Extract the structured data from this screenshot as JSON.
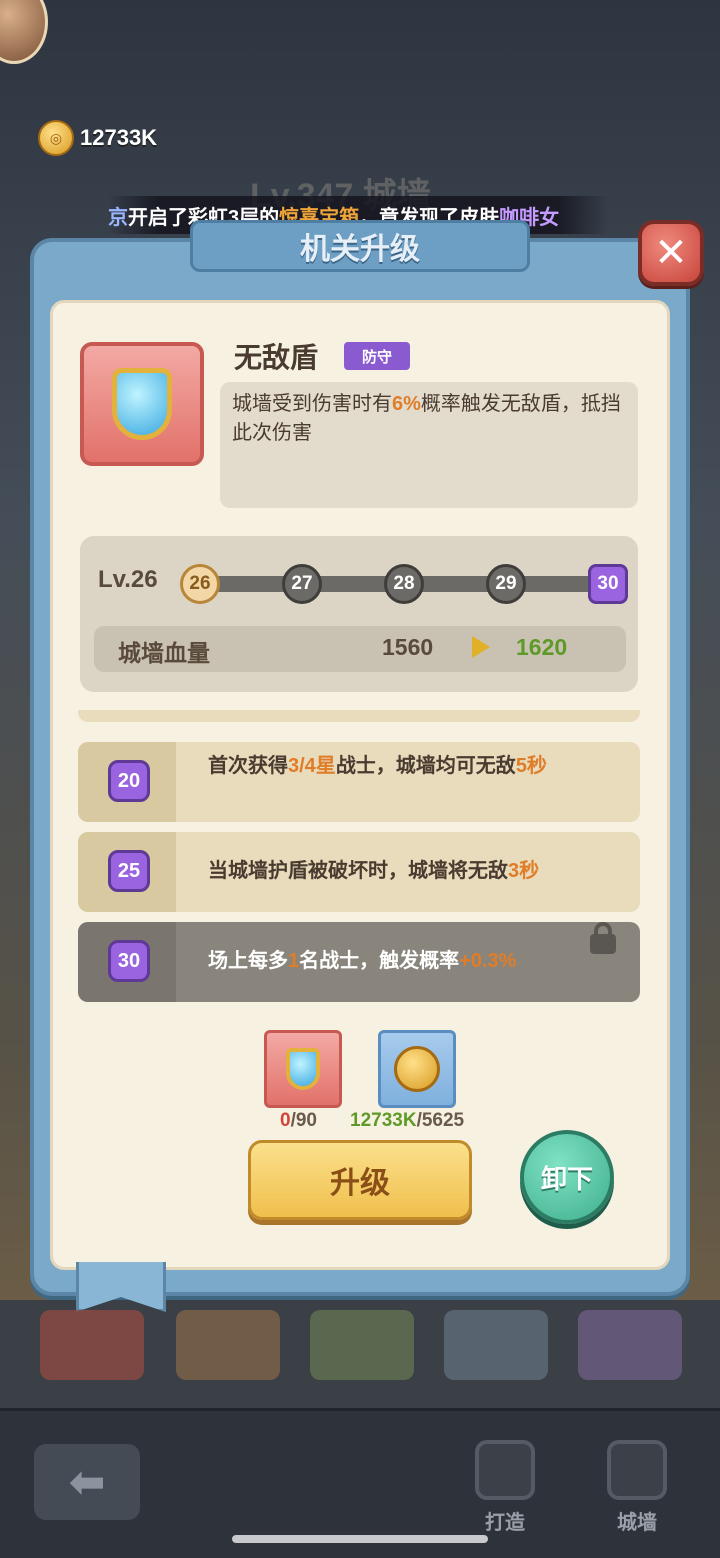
{
  "currency": {
    "amount": "12733K"
  },
  "background": {
    "title": "Lv.347 城墙"
  },
  "ticker": {
    "prefix": "京",
    "part1": "开启了彩虹3层的",
    "highlight1": "惊喜宝箱",
    "part2": "，竟发现了皮肤",
    "highlight2": "咖啡女"
  },
  "dialog": {
    "title": "机关升级"
  },
  "skill": {
    "name": "无敌盾",
    "tag": "防守",
    "desc_part1": "城墙受到伤害时有",
    "desc_pct": "6%",
    "desc_part2": "概率触发无敌盾，抵挡此次伤害"
  },
  "level": {
    "label": "Lv.26",
    "nodes": [
      "26",
      "27",
      "28",
      "29",
      "30"
    ]
  },
  "stat": {
    "label": "城墙血量",
    "current": "1560",
    "next": "1620"
  },
  "perks": [
    {
      "level": "20",
      "text_a": "首次获得",
      "hl_a": "3/4星",
      "text_b": "战士，城墙均可无敌",
      "hl_b": "5秒",
      "locked": false
    },
    {
      "level": "25",
      "text_a": "当城墙护盾被破坏时，城墙将无敌",
      "hl_a": "3秒",
      "text_b": "",
      "hl_b": "",
      "locked": false
    },
    {
      "level": "30",
      "text_a": "场上每多",
      "hl_a": "1",
      "text_b": "名战士，触发概率",
      "hl_b": "+0.3%",
      "locked": true
    }
  ],
  "costs": {
    "shield": {
      "have": "0",
      "need": "/90"
    },
    "coin": {
      "have": "12733K",
      "need": "/5625"
    }
  },
  "buttons": {
    "upgrade": "升级",
    "unload": "卸下"
  },
  "nav": {
    "forge": "打造",
    "wall": "城墙"
  },
  "colors": {
    "accent_orange": "#e07d28",
    "accent_green": "#5f9a28",
    "accent_purple": "#9a63e0"
  }
}
